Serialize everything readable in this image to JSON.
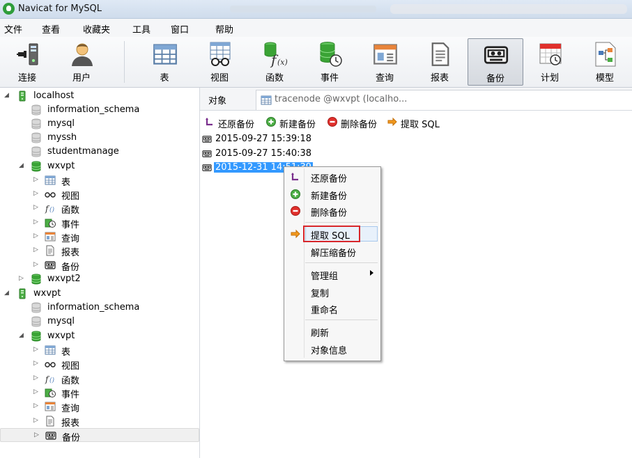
{
  "window": {
    "title": "Navicat for MySQL"
  },
  "menu": [
    "文件",
    "查看",
    "收藏夹",
    "工具",
    "窗口",
    "帮助"
  ],
  "toolbar": [
    {
      "label": "连接",
      "icon": "connection-icon"
    },
    {
      "label": "用户",
      "icon": "user-icon"
    },
    {
      "label": "表",
      "icon": "table-icon"
    },
    {
      "label": "视图",
      "icon": "view-icon"
    },
    {
      "label": "函数",
      "icon": "function-icon"
    },
    {
      "label": "事件",
      "icon": "event-icon"
    },
    {
      "label": "查询",
      "icon": "query-icon"
    },
    {
      "label": "报表",
      "icon": "report-icon"
    },
    {
      "label": "备份",
      "icon": "backup-icon",
      "active": true
    },
    {
      "label": "计划",
      "icon": "schedule-icon"
    },
    {
      "label": "模型",
      "icon": "model-icon"
    }
  ],
  "tree": [
    {
      "label": "localhost",
      "icon": "server-icon",
      "expanded": true
    },
    {
      "label": "information_schema",
      "icon": "database-gray-icon"
    },
    {
      "label": "mysql",
      "icon": "database-gray-icon"
    },
    {
      "label": "myssh",
      "icon": "database-gray-icon"
    },
    {
      "label": "studentmanage",
      "icon": "database-gray-icon"
    },
    {
      "label": "wxvpt",
      "icon": "database-green-icon",
      "expanded": true
    },
    {
      "label": "表",
      "icon": "table-icon"
    },
    {
      "label": "视图",
      "icon": "view-icon"
    },
    {
      "label": "函数",
      "icon": "function-icon"
    },
    {
      "label": "事件",
      "icon": "event-icon"
    },
    {
      "label": "查询",
      "icon": "query-icon"
    },
    {
      "label": "报表",
      "icon": "report-icon"
    },
    {
      "label": "备份",
      "icon": "backup-icon"
    },
    {
      "label": "wxvpt2",
      "icon": "database-green-icon"
    },
    {
      "label": "wxvpt",
      "icon": "server-icon",
      "expanded": true
    },
    {
      "label": "information_schema",
      "icon": "database-gray-icon"
    },
    {
      "label": "mysql",
      "icon": "database-gray-icon"
    },
    {
      "label": "wxvpt",
      "icon": "database-green-icon",
      "expanded": true
    },
    {
      "label": "表",
      "icon": "table-icon"
    },
    {
      "label": "视图",
      "icon": "view-icon"
    },
    {
      "label": "函数",
      "icon": "function-icon"
    },
    {
      "label": "事件",
      "icon": "event-icon"
    },
    {
      "label": "查询",
      "icon": "query-icon"
    },
    {
      "label": "报表",
      "icon": "report-icon"
    },
    {
      "label": "备份",
      "icon": "backup-icon",
      "selected": true
    }
  ],
  "tabs": {
    "object": "对象",
    "query": "tracenode @wxvpt (localho..."
  },
  "actions": [
    {
      "label": "还原备份",
      "icon": "restore-backup-icon"
    },
    {
      "label": "新建备份",
      "icon": "new-backup-icon"
    },
    {
      "label": "删除备份",
      "icon": "delete-backup-icon"
    },
    {
      "label": "提取 SQL",
      "icon": "extract-sql-icon"
    }
  ],
  "backups": [
    {
      "label": "2015-09-27 15:39:18"
    },
    {
      "label": "2015-09-27 15:40:38"
    },
    {
      "label": "2015-12-31 14:51:39",
      "selected": true
    }
  ],
  "context_menu": {
    "items": [
      {
        "label": "还原备份",
        "icon": "restore-backup-icon"
      },
      {
        "label": "新建备份",
        "icon": "new-backup-icon"
      },
      {
        "label": "删除备份",
        "icon": "delete-backup-icon"
      },
      {
        "separator": true
      },
      {
        "label": "提取 SQL",
        "icon": "extract-sql-icon",
        "highlighted": true
      },
      {
        "label": "解压缩备份"
      },
      {
        "separator": true
      },
      {
        "label": "管理组",
        "submenu": true
      },
      {
        "label": "复制"
      },
      {
        "label": "重命名"
      },
      {
        "separator": true
      },
      {
        "label": "刷新"
      },
      {
        "label": "对象信息"
      }
    ]
  },
  "colors": {
    "selection": "#3399ff",
    "highlight_box": "#d8262b",
    "db_green": "#3aa335"
  }
}
